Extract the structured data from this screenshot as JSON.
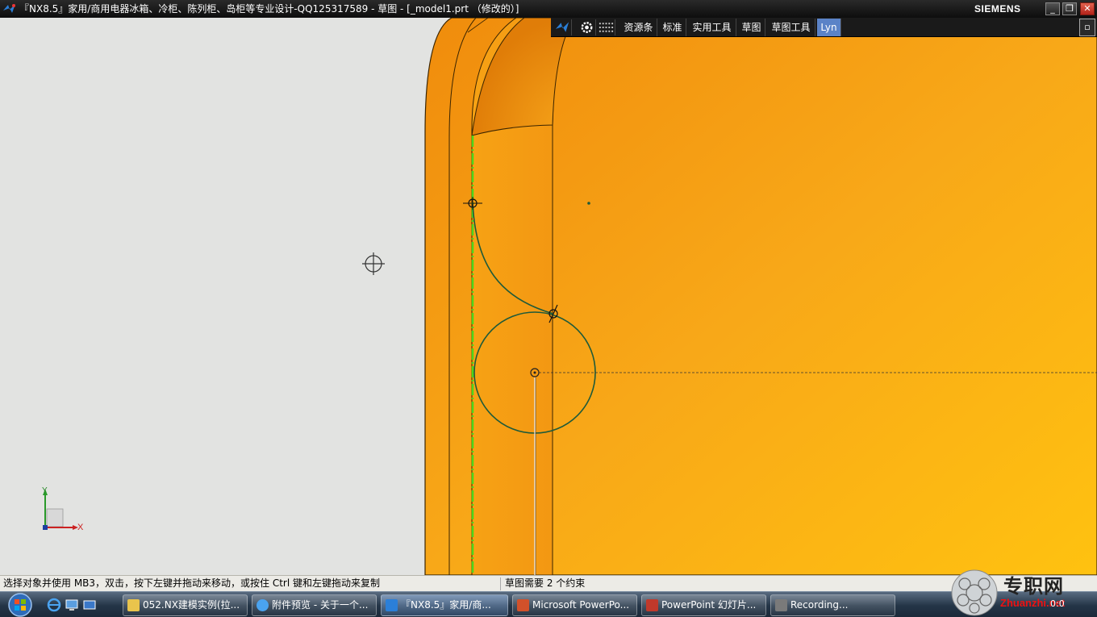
{
  "window": {
    "title": "『NX8.5』家用/商用电器冰箱、冷柜、陈列柜、岛柜等专业设计-QQ125317589 - 草图 - [_model1.prt （修改的）]",
    "brand": "SIEMENS",
    "minimize": "_",
    "restore": "❐",
    "close": "✕"
  },
  "toolbar": {
    "items": [
      "资源条",
      "标准",
      "实用工具",
      "草图",
      "草图工具",
      "Lyn"
    ],
    "active_item": "Lyn",
    "grip": "▫"
  },
  "triad": {
    "y_label": "Y",
    "x_label": "X"
  },
  "statusbar": {
    "prompt": "选择对象并使用 MB3，双击，按下左键并拖动来移动，或按住 Ctrl 键和左键拖动来复制",
    "constraint_status": "草图需要 2 个约束"
  },
  "taskbar": {
    "tasks": [
      {
        "label": "052.NX建模实例(拉...",
        "icon": "folder-icon"
      },
      {
        "label": "附件预览 - 关于一个...",
        "icon": "ie-icon"
      },
      {
        "label": "『NX8.5』家用/商...",
        "icon": "nx-icon",
        "active": true
      },
      {
        "label": "Microsoft PowerPo...",
        "icon": "powerpoint-icon"
      },
      {
        "label": "PowerPoint 幻灯片...",
        "icon": "powerpoint-slide-icon"
      },
      {
        "label": "Recording...",
        "icon": "recording-icon"
      }
    ],
    "clock": "0:0"
  },
  "watermark": {
    "text": "专职网",
    "url": "Zhuanzhi.net"
  },
  "colors": {
    "part_orange": "#f7a516",
    "sketch_curve": "#1e5a3a",
    "constraint_green": "#4bd61c"
  }
}
